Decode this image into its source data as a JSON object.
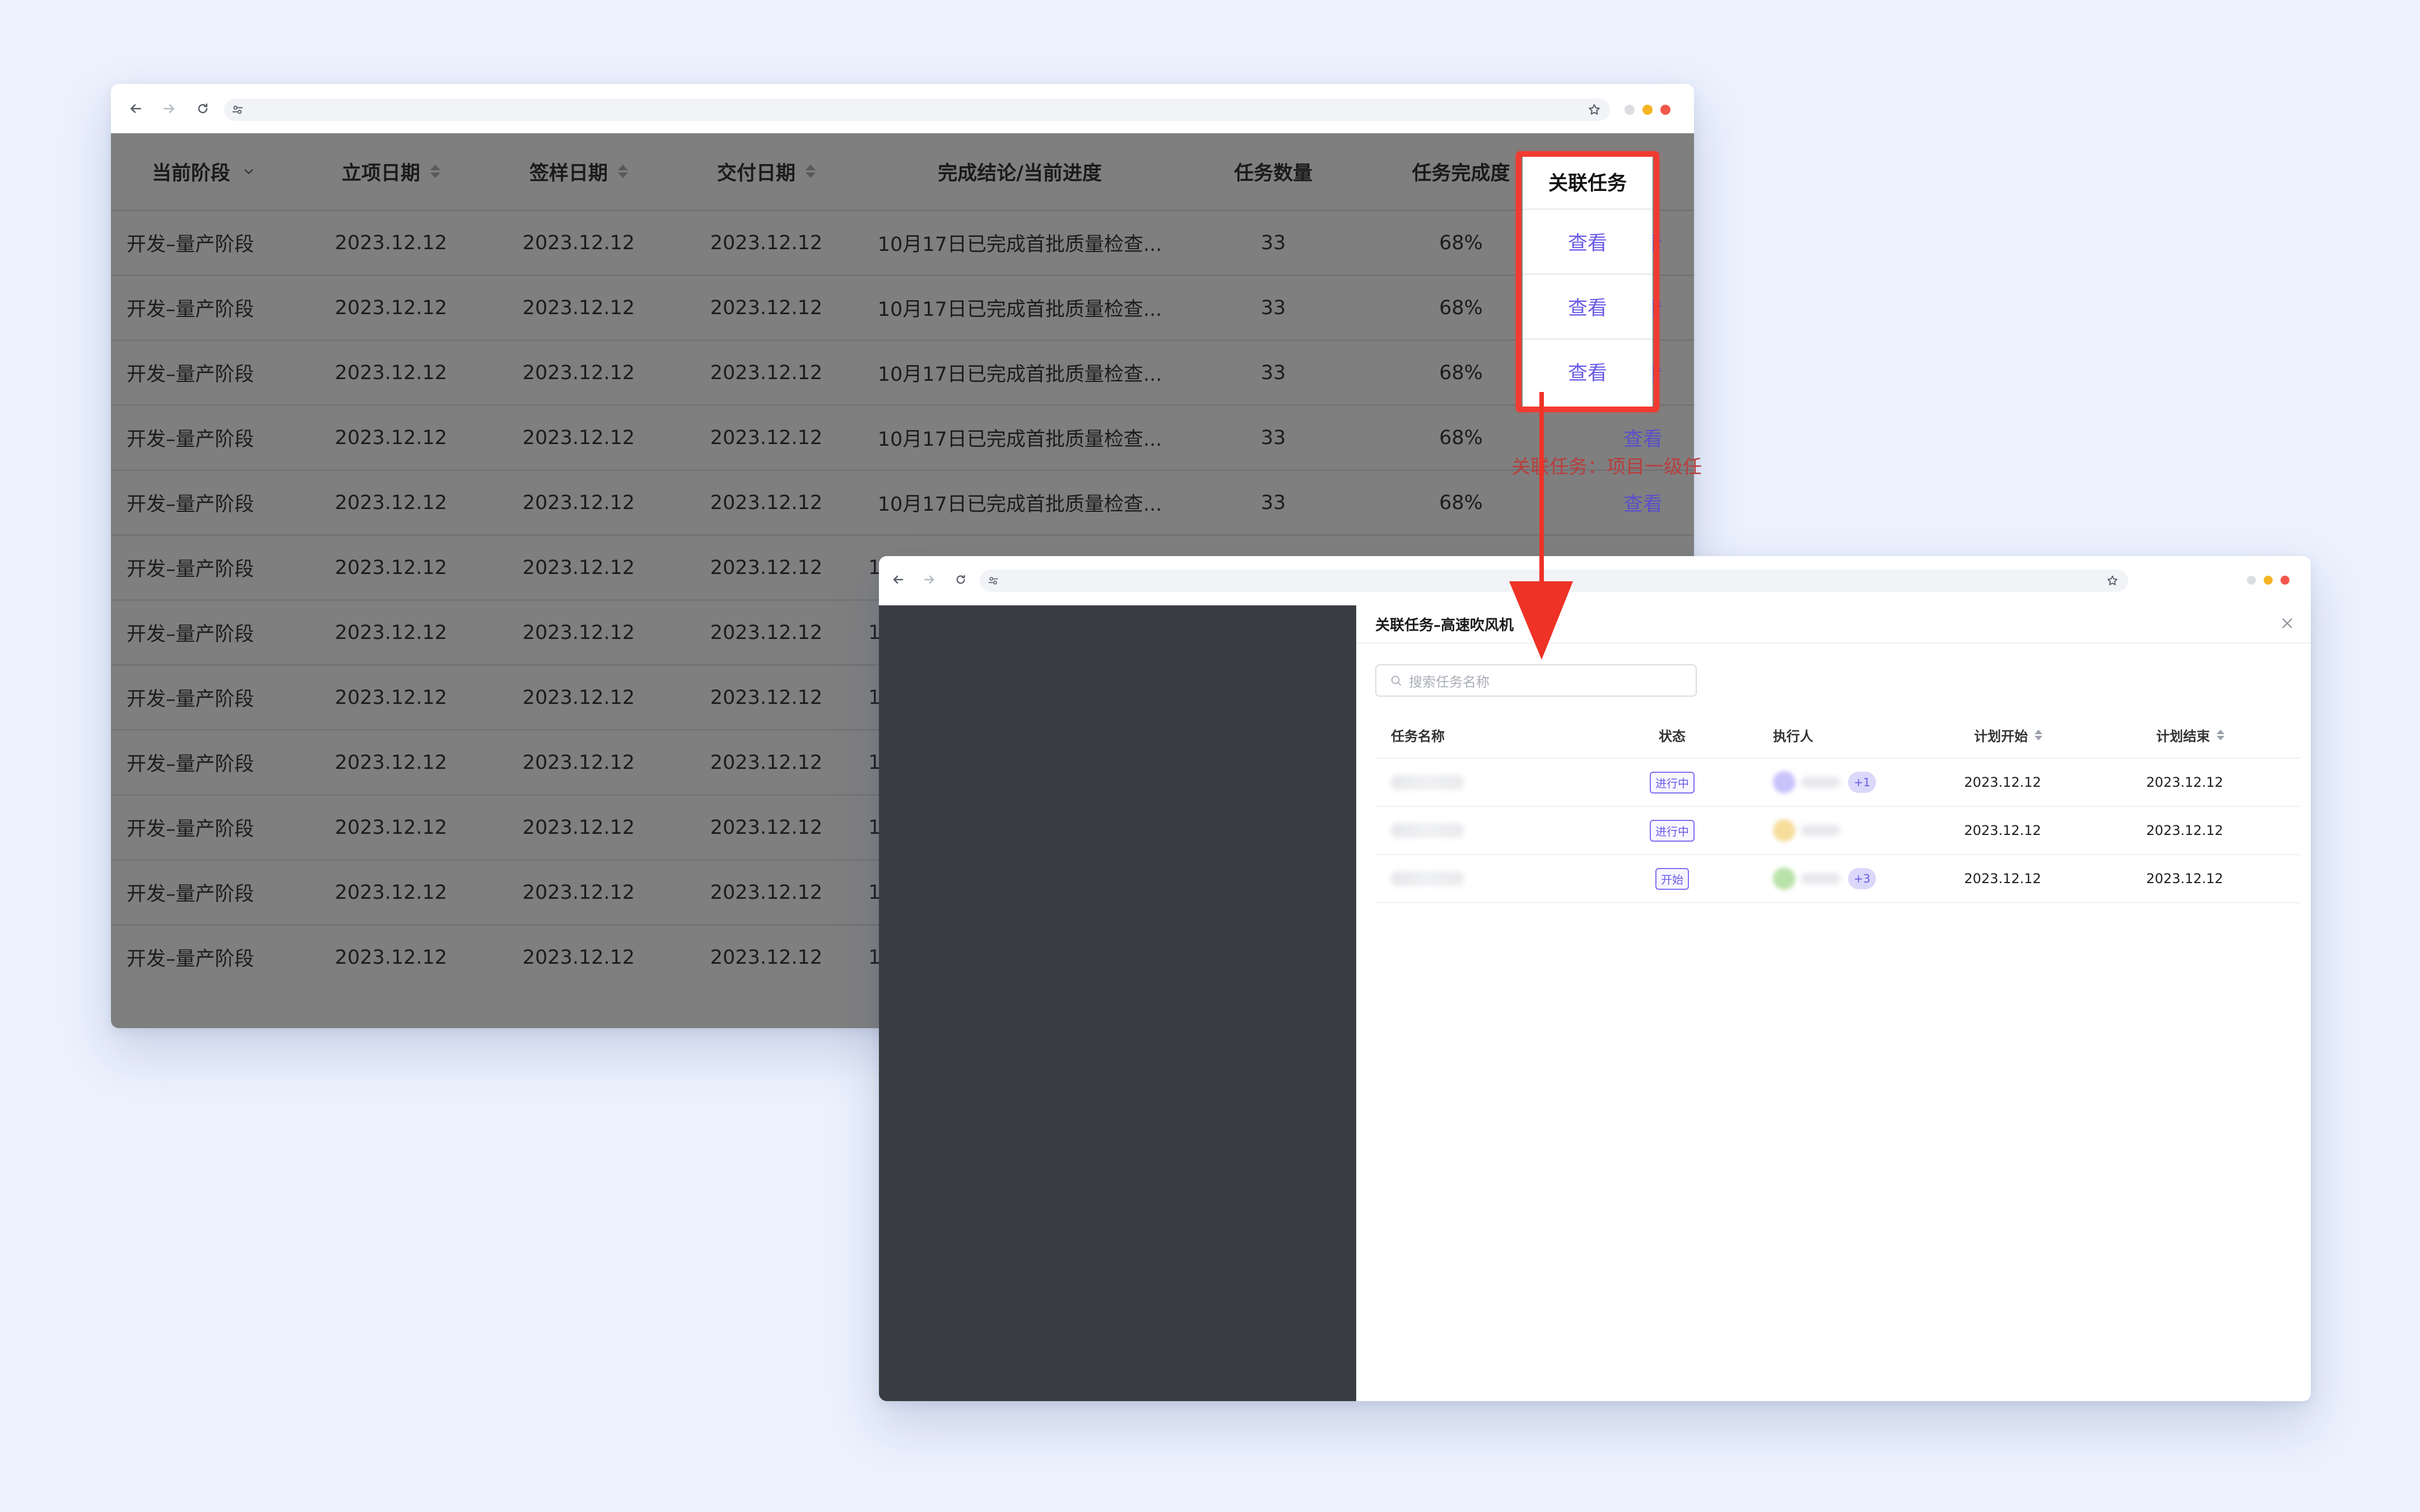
{
  "main_window": {
    "columns": {
      "stage": "当前阶段",
      "setup_date": "立项日期",
      "sample_date": "签样日期",
      "delivery_date": "交付日期",
      "conclusion": "完成结论/当前进度",
      "task_count": "任务数量",
      "completion": "任务完成度",
      "linked_tasks": "关联任务"
    },
    "rows": [
      {
        "stage": "开发–量产阶段",
        "setup_date": "2023.12.12",
        "sample_date": "2023.12.12",
        "delivery_date": "2023.12.12",
        "conclusion": "10月17日已完成首批质量检查...",
        "task_count": "33",
        "completion": "68%",
        "link": "查看"
      },
      {
        "stage": "开发–量产阶段",
        "setup_date": "2023.12.12",
        "sample_date": "2023.12.12",
        "delivery_date": "2023.12.12",
        "conclusion": "10月17日已完成首批质量检查...",
        "task_count": "33",
        "completion": "68%",
        "link": "查看"
      },
      {
        "stage": "开发–量产阶段",
        "setup_date": "2023.12.12",
        "sample_date": "2023.12.12",
        "delivery_date": "2023.12.12",
        "conclusion": "10月17日已完成首批质量检查...",
        "task_count": "33",
        "completion": "68%",
        "link": "查看"
      },
      {
        "stage": "开发–量产阶段",
        "setup_date": "2023.12.12",
        "sample_date": "2023.12.12",
        "delivery_date": "2023.12.12",
        "conclusion": "10月17日已完成首批质量检查...",
        "task_count": "33",
        "completion": "68%",
        "link": "查看"
      },
      {
        "stage": "开发–量产阶段",
        "setup_date": "2023.12.12",
        "sample_date": "2023.12.12",
        "delivery_date": "2023.12.12",
        "conclusion": "10月17日已完成首批质量检查...",
        "task_count": "33",
        "completion": "68%",
        "link": "查看"
      },
      {
        "stage": "开发–量产阶段",
        "setup_date": "2023.12.12",
        "sample_date": "2023.12.12",
        "delivery_date": "2023.12.12",
        "conclusion": "1"
      },
      {
        "stage": "开发–量产阶段",
        "setup_date": "2023.12.12",
        "sample_date": "2023.12.12",
        "delivery_date": "2023.12.12",
        "conclusion": "1"
      },
      {
        "stage": "开发–量产阶段",
        "setup_date": "2023.12.12",
        "sample_date": "2023.12.12",
        "delivery_date": "2023.12.12",
        "conclusion": "1"
      },
      {
        "stage": "开发–量产阶段",
        "setup_date": "2023.12.12",
        "sample_date": "2023.12.12",
        "delivery_date": "2023.12.12",
        "conclusion": "1"
      },
      {
        "stage": "开发–量产阶段",
        "setup_date": "2023.12.12",
        "sample_date": "2023.12.12",
        "delivery_date": "2023.12.12",
        "conclusion": "1"
      },
      {
        "stage": "开发–量产阶段",
        "setup_date": "2023.12.12",
        "sample_date": "2023.12.12",
        "delivery_date": "2023.12.12",
        "conclusion": "1"
      },
      {
        "stage": "开发–量产阶段",
        "setup_date": "2023.12.12",
        "sample_date": "2023.12.12",
        "delivery_date": "2023.12.12",
        "conclusion": "1"
      }
    ],
    "highlight": {
      "header": "关联任务",
      "links": [
        "查看",
        "查看",
        "查看"
      ]
    },
    "tooltip": "关联任务：项目一级任"
  },
  "drawer_window": {
    "title": "关联任务–高速吹风机",
    "search_placeholder": "搜索任务名称",
    "columns": {
      "name": "任务名称",
      "status": "状态",
      "assignee": "执行人",
      "plan_start": "计划开始",
      "plan_end": "计划结束"
    },
    "rows": [
      {
        "status": "进行中",
        "extra": "+1",
        "start": "2023.12.12",
        "end": "2023.12.12",
        "avatar_color": "#c9c3fb"
      },
      {
        "status": "进行中",
        "extra": "",
        "start": "2023.12.12",
        "end": "2023.12.12",
        "avatar_color": "#f6dd9c"
      },
      {
        "status": "开始",
        "extra": "+3",
        "start": "2023.12.12",
        "end": "2023.12.12",
        "avatar_color": "#b9e2a8"
      }
    ]
  },
  "colors": {
    "accent": "#6a5ae6",
    "highlight_red": "#f23a30",
    "overlay_gray": "#7f7f7f",
    "dark_sidebar": "#393c41"
  }
}
